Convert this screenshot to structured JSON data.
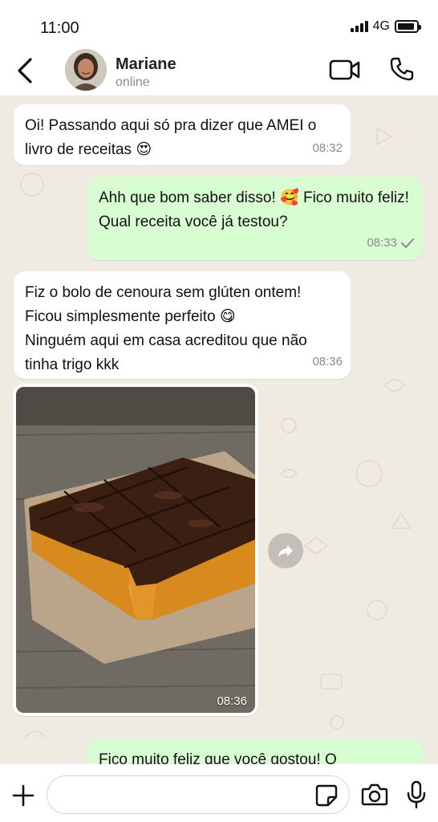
{
  "status_bar": {
    "time": "11:00",
    "network": "4G",
    "battery_level": 0.9
  },
  "header": {
    "contact_name": "Mariane",
    "contact_status": "online"
  },
  "messages": [
    {
      "direction": "in",
      "text": "Oi! Passando aqui só pra dizer que AMEI o livro de receitas 😍",
      "time": "08:32"
    },
    {
      "direction": "out",
      "text": "Ahh que bom saber disso! 🥰 Fico muito feliz! Qual receita você já testou?",
      "time": "08:33",
      "status": "sent"
    },
    {
      "direction": "in",
      "line1": "Fiz o bolo de cenoura sem glúten ontem!",
      "line2": "Ficou simplesmente perfeito 😋",
      "line3": "Ninguém aqui em casa acreditou que não tinha trigo kkk",
      "time": "08:36"
    },
    {
      "direction": "in",
      "type": "image",
      "image_subject": "bolo de cenoura com cobertura de chocolate",
      "time": "08:36"
    },
    {
      "direction": "out",
      "text": "Fico muito feliz que você gostou! O"
    }
  ],
  "input": {
    "placeholder": ""
  },
  "icons": {
    "back": "chevron-left-icon",
    "video": "video-camera-icon",
    "call": "phone-icon",
    "forward": "forward-arrow-icon",
    "plus": "plus-icon",
    "sticker": "sticker-icon",
    "camera": "camera-icon",
    "mic": "microphone-icon"
  },
  "colors": {
    "incoming_bubble": "#ffffff",
    "outgoing_bubble": "#d9fdd3",
    "chat_background": "#efeae2",
    "timestamp": "#8a8a8a"
  }
}
